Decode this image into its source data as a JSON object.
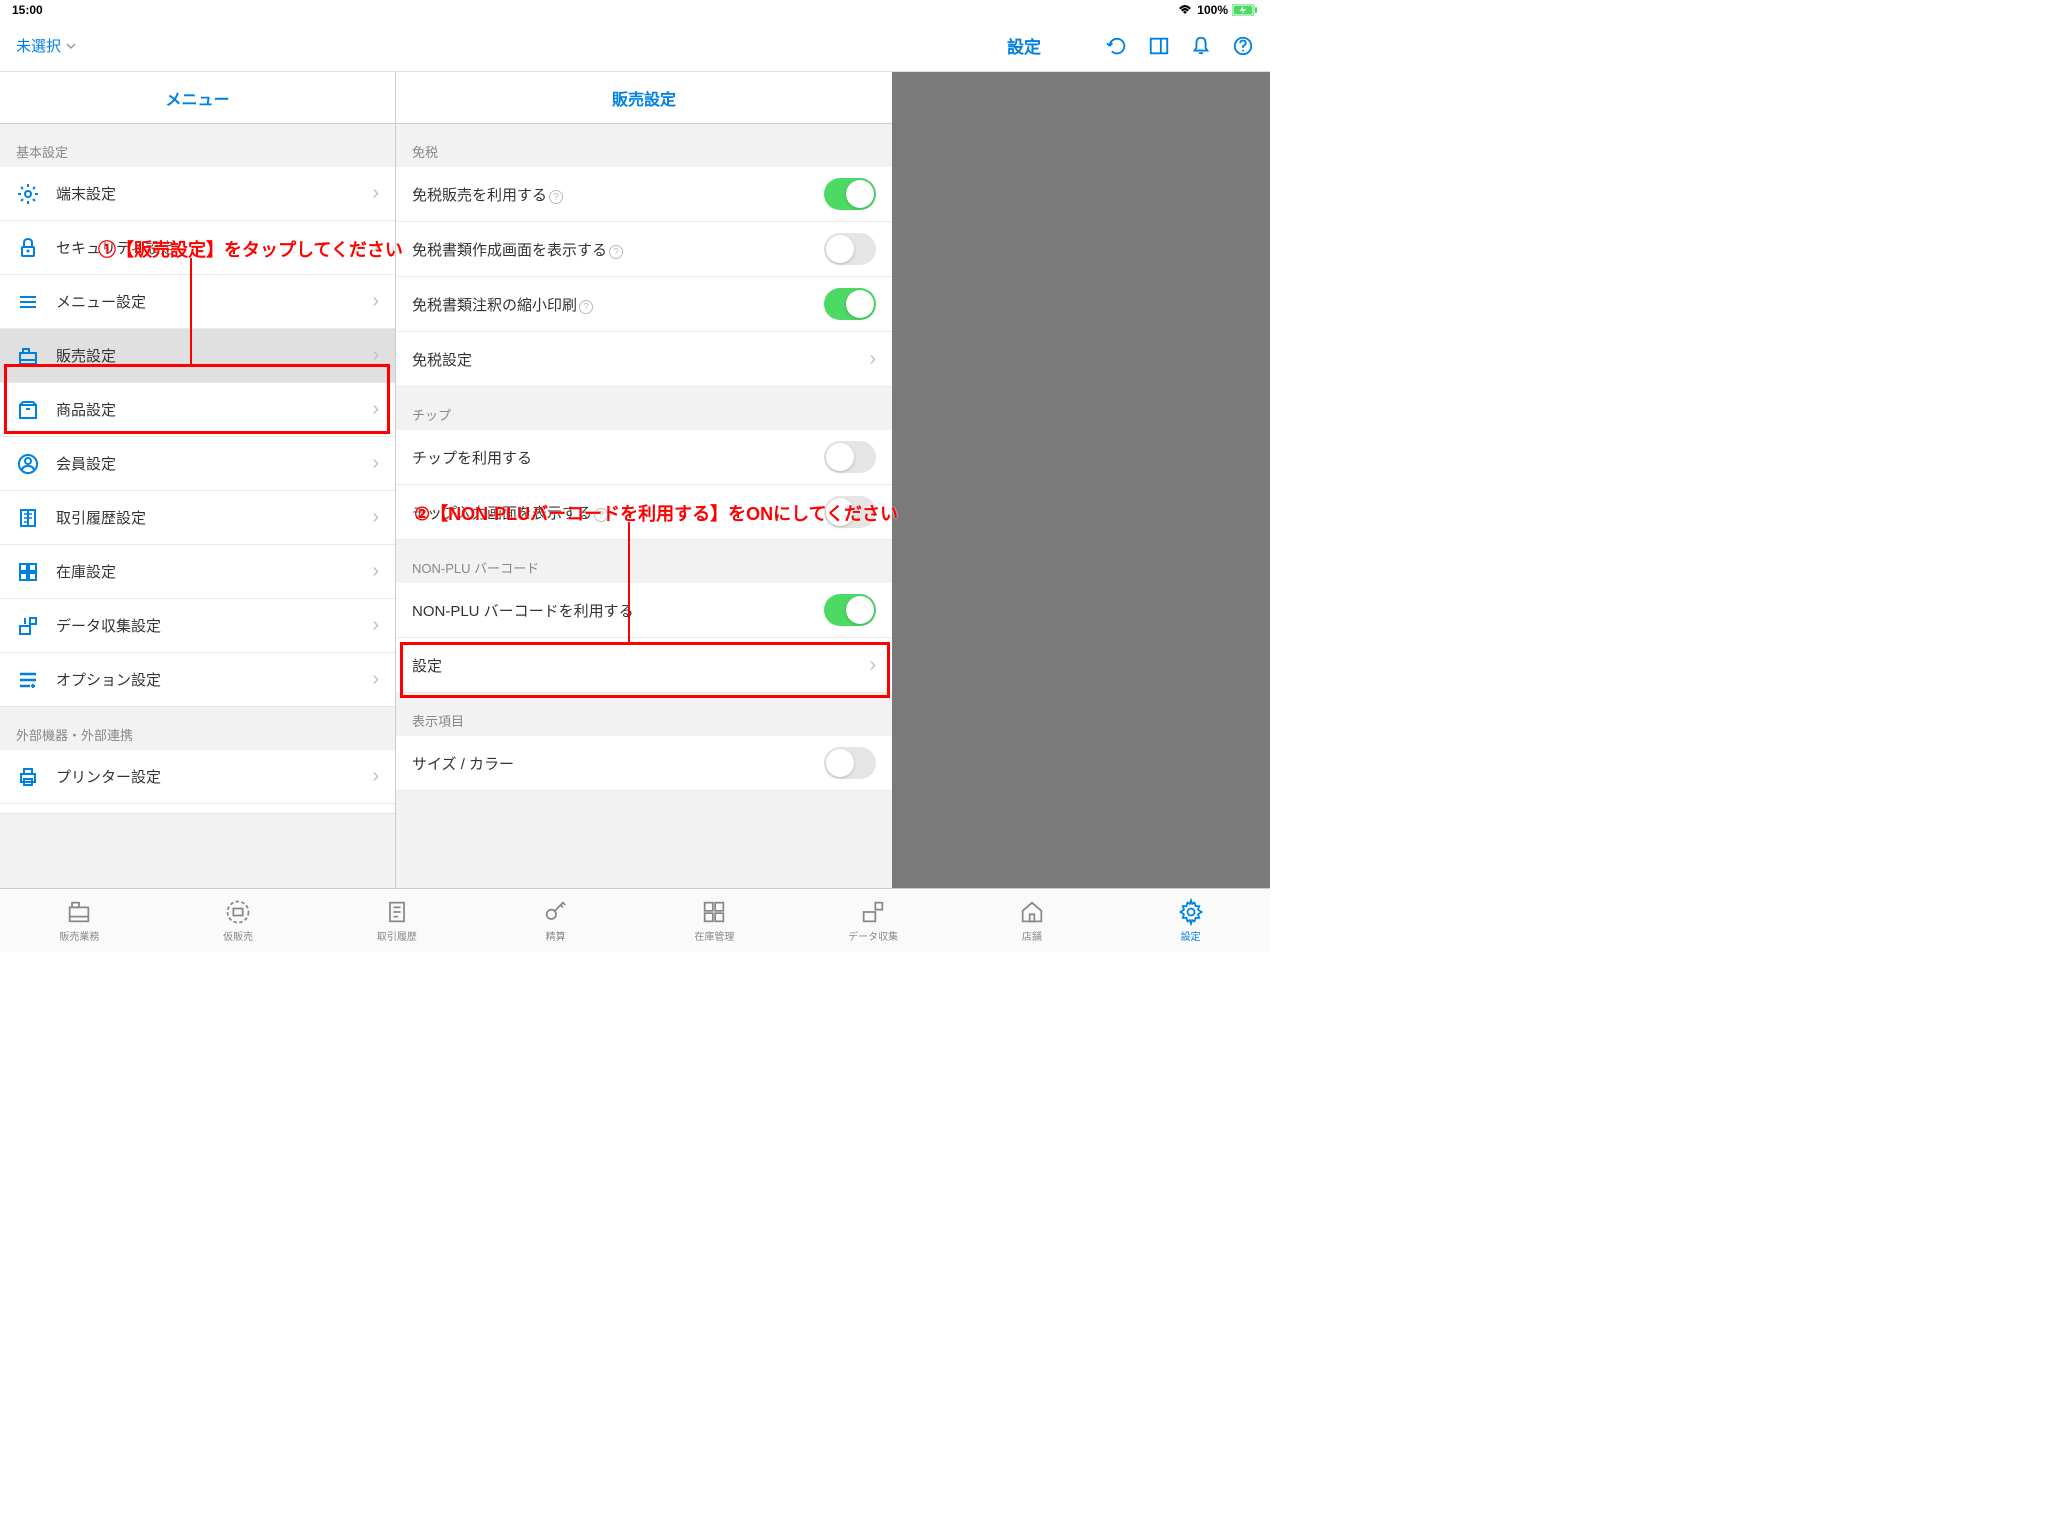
{
  "status": {
    "time": "15:00",
    "battery": "100%"
  },
  "nav": {
    "left_label": "未選択",
    "title": "設定"
  },
  "sidebar": {
    "header": "メニュー",
    "sections": [
      {
        "title": "基本設定",
        "items": [
          {
            "label": "端末設定",
            "icon": "gear"
          },
          {
            "label": "セキュリティ設定",
            "icon": "lock"
          },
          {
            "label": "メニュー設定",
            "icon": "menu"
          },
          {
            "label": "販売設定",
            "icon": "register",
            "selected": true
          },
          {
            "label": "商品設定",
            "icon": "box"
          },
          {
            "label": "会員設定",
            "icon": "user"
          },
          {
            "label": "取引履歴設定",
            "icon": "receipt"
          },
          {
            "label": "在庫設定",
            "icon": "grid"
          },
          {
            "label": "データ収集設定",
            "icon": "collect"
          },
          {
            "label": "オプション設定",
            "icon": "lines"
          }
        ]
      },
      {
        "title": "外部機器・外部連携",
        "items": [
          {
            "label": "プリンター設定",
            "icon": "printer"
          }
        ]
      }
    ]
  },
  "main": {
    "header": "販売設定",
    "groups": [
      {
        "title": "免税",
        "rows": [
          {
            "label": "免税販売を利用する",
            "type": "toggle",
            "on": true,
            "help": true
          },
          {
            "label": "免税書類作成画面を表示する",
            "type": "toggle",
            "on": false,
            "help": true
          },
          {
            "label": "免税書類注釈の縮小印刷",
            "type": "toggle",
            "on": true,
            "help": true
          },
          {
            "label": "免税設定",
            "type": "link"
          }
        ]
      },
      {
        "title": "チップ",
        "rows": [
          {
            "label": "チップを利用する",
            "type": "toggle",
            "on": false
          },
          {
            "label": "チップ入力画面を表示する",
            "type": "toggle",
            "on": false,
            "help": true
          }
        ]
      },
      {
        "title": "NON-PLU バーコード",
        "rows": [
          {
            "label": "NON-PLU バーコードを利用する",
            "type": "toggle",
            "on": true
          },
          {
            "label": "設定",
            "type": "link"
          }
        ]
      },
      {
        "title": "表示項目",
        "rows": [
          {
            "label": "サイズ / カラー",
            "type": "toggle",
            "on": false
          }
        ]
      }
    ]
  },
  "tabs": [
    {
      "label": "販売業務"
    },
    {
      "label": "仮販売"
    },
    {
      "label": "取引履歴"
    },
    {
      "label": "精算"
    },
    {
      "label": "在庫管理"
    },
    {
      "label": "データ収集"
    },
    {
      "label": "店舗"
    },
    {
      "label": "設定",
      "active": true
    }
  ],
  "annotations": {
    "a1": "①【販売設定】をタップしてください",
    "a2": "②【NON-PLUバーコードを利用する】をONにしてください"
  }
}
